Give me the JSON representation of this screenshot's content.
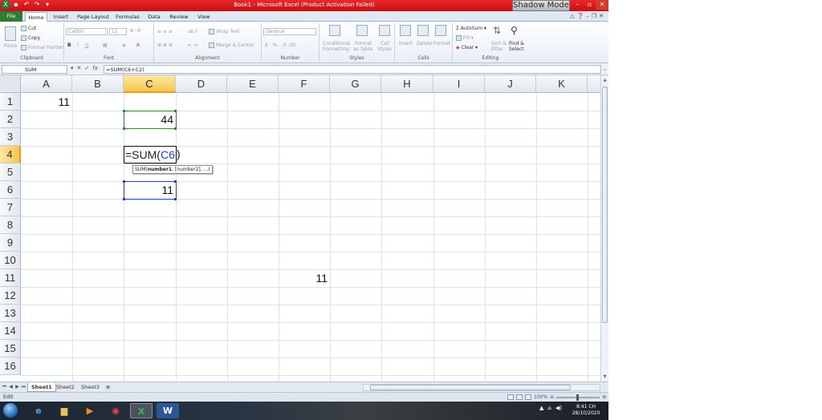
{
  "window": {
    "title": "Book1 - Microsoft Excel (Product Activation Failed)",
    "shadow_mode": "Shadow Mode"
  },
  "tabs": [
    "File",
    "Home",
    "Insert",
    "Page Layout",
    "Formulas",
    "Data",
    "Review",
    "View"
  ],
  "ribbon": {
    "clipboard": {
      "label": "Clipboard",
      "paste": "Paste",
      "cut": "Cut",
      "copy": "Copy",
      "format_painter": "Format Painter"
    },
    "font": {
      "label": "Font",
      "name": "Calibri",
      "size": "11"
    },
    "alignment": {
      "label": "Alignment",
      "wrap_text": "Wrap Text",
      "merge_center": "Merge & Center"
    },
    "number": {
      "label": "Number",
      "format": "General"
    },
    "styles": {
      "label": "Styles",
      "conditional": "Conditional",
      "conditional2": "Formatting",
      "format_as": "Format",
      "format_as2": "as Table",
      "cell": "Cell",
      "cell2": "Styles"
    },
    "cells": {
      "label": "Cells",
      "insert": "Insert",
      "delete": "Delete",
      "format": "Format"
    },
    "editing": {
      "label": "Editing",
      "autosum": "AutoSum",
      "fill": "Fill",
      "clear": "Clear",
      "sort": "Sort &",
      "sort2": "Filter",
      "find": "Find &",
      "find2": "Select"
    }
  },
  "formula_bar": {
    "name_box": "SUM",
    "formula": "=SUM(C6+C2)"
  },
  "columns": [
    "A",
    "B",
    "C",
    "D",
    "E",
    "F",
    "G",
    "H",
    "I",
    "J",
    "K"
  ],
  "selected_column": "C",
  "rows": [
    "1",
    "2",
    "3",
    "4",
    "5",
    "6",
    "7",
    "8",
    "9",
    "10",
    "11",
    "12",
    "13",
    "14",
    "15",
    "16"
  ],
  "selected_row": "4",
  "cells": {
    "A1": "11",
    "C2": "44",
    "C6": "11",
    "F11": "11"
  },
  "edit_cell": {
    "ref": "C4",
    "prefix": "=SUM(",
    "ref1": "C6",
    "plus": "+",
    "ref2": "C2",
    "suffix": ")"
  },
  "tooltip": {
    "fn": "SUM(",
    "arg1": "number1",
    "rest": ", [number2], ...)"
  },
  "sheets": [
    "Sheet1",
    "Sheet2",
    "Sheet3"
  ],
  "active_sheet": "Sheet1",
  "status": {
    "mode": "Edit",
    "zoom": "100%"
  },
  "taskbar": {
    "time": "8:41 CH",
    "date": "28/10/2020"
  },
  "colors": {
    "ref_blue": "#1f3fd6",
    "ref_green": "#2b8a2b",
    "selection_header": "#f6c64c"
  }
}
